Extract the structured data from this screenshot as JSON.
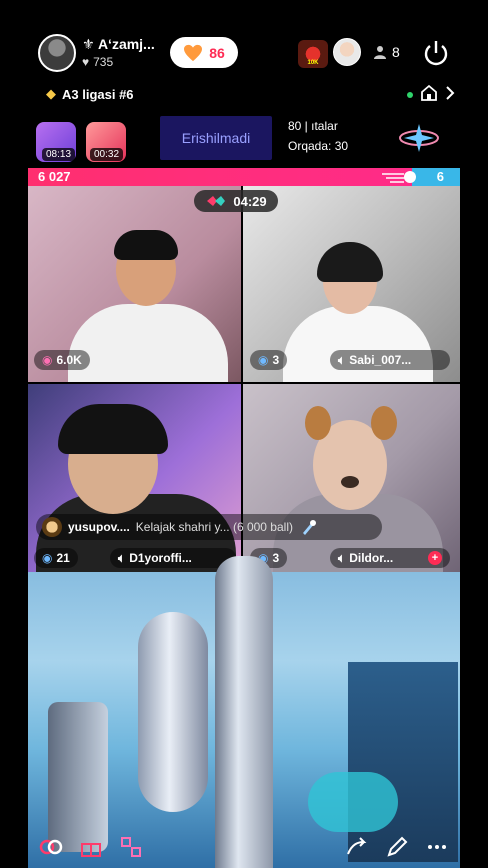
{
  "header": {
    "host_name": "Aʻzamj...",
    "host_likes": "735",
    "likes_pill": "86",
    "viewer_badge": "10K",
    "viewer_count": "8"
  },
  "league": {
    "label": "A3 ligasi #6"
  },
  "boxes": {
    "timer1": "08:13",
    "timer2": "00:32"
  },
  "unreached_label": "Erishilmadi",
  "rank": {
    "line1": "80 | ıtalar",
    "line2": "Orqada: 30"
  },
  "score": {
    "left": "6 027",
    "right": "6"
  },
  "battle_timer": "04:29",
  "tiles": [
    {
      "stat": "6.0K"
    },
    {
      "stat": "3",
      "name": "Sabi_007..."
    },
    {
      "stat": "21",
      "name": "D1yoroffi..."
    },
    {
      "stat": "3",
      "name": "Dildor..."
    }
  ],
  "comment": {
    "user": "yusupov....",
    "text": "Kelajak shahri  y...  (6 000 ball)"
  },
  "colors": {
    "accent_pink": "#fe2c55",
    "score_blue": "#39b7e8",
    "live_green": "#2fd36b"
  }
}
